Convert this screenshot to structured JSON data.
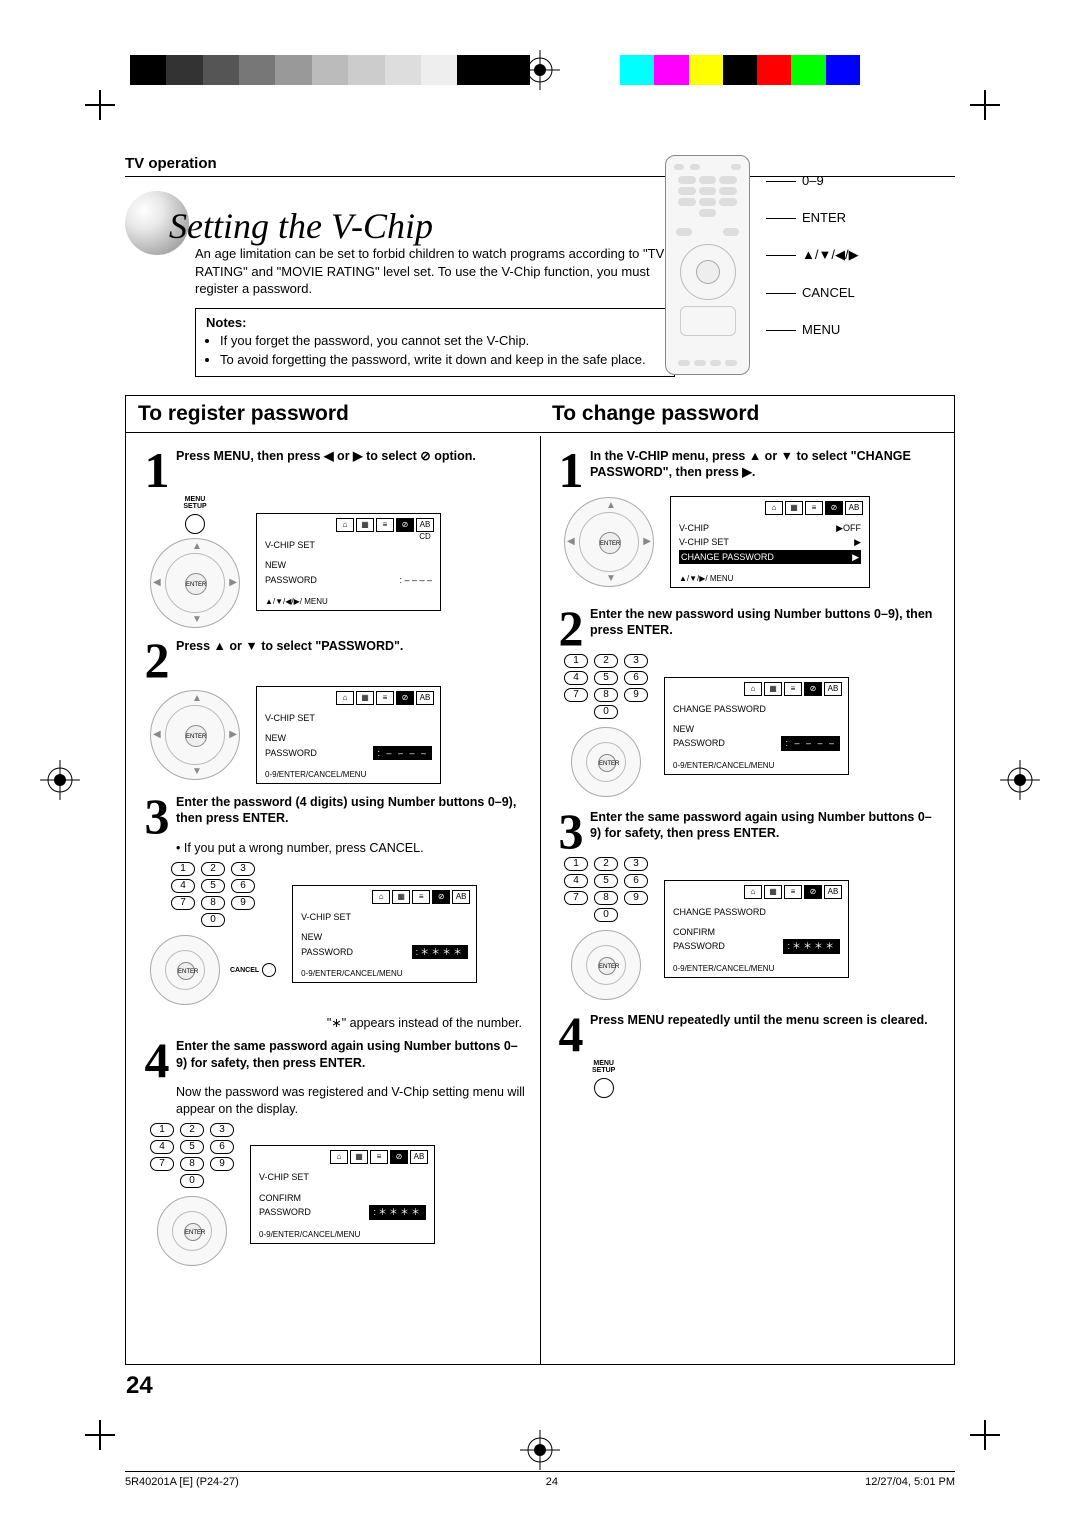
{
  "header": {
    "section": "TV operation",
    "title": "Setting the V-Chip"
  },
  "intro": "An age limitation can be set to forbid children to watch programs according to \"TV RATING\" and \"MOVIE RATING\" level set. To use the V-Chip function, you must register a password.",
  "notes": {
    "heading": "Notes:",
    "items": [
      "If you forget the password, you cannot set the V-Chip.",
      "To avoid forgetting the password, write it down and keep in the safe place."
    ]
  },
  "remote_labels": [
    "0–9",
    "ENTER",
    "▲/▼/◀/▶",
    "CANCEL",
    "MENU"
  ],
  "left_column": {
    "heading": "To register password",
    "steps": [
      {
        "n": "1",
        "text": "Press MENU, then press ◀ or ▶ to select ⊘ option."
      },
      {
        "n": "2",
        "text": "Press ▲ or ▼ to select \"PASSWORD\"."
      },
      {
        "n": "3",
        "text": "Enter the password (4 digits) using Number buttons 0–9), then press ENTER.",
        "sub": "• If you put a wrong number, press CANCEL.",
        "after": "\"∗\" appears instead of the number."
      },
      {
        "n": "4",
        "text": "Enter the same password again using Number buttons 0–9) for safety, then press ENTER.",
        "sub": "Now the password was registered and V-Chip setting menu will appear on the display."
      }
    ],
    "osd": {
      "title": "V-CHIP SET",
      "row_new": "NEW",
      "row_password": "PASSWORD",
      "dashes": ": – – – –",
      "stars": ":＊＊＊＊",
      "confirm": "CONFIRM",
      "foot1": "▲/▼/◀/▶/ MENU",
      "foot2": "0-9/ENTER/CANCEL/MENU"
    }
  },
  "right_column": {
    "heading": "To change password",
    "steps": [
      {
        "n": "1",
        "text": "In the V-CHIP menu, press ▲ or ▼ to select \"CHANGE PASSWORD\", then press ▶."
      },
      {
        "n": "2",
        "text": "Enter the new password using Number buttons 0–9), then press ENTER."
      },
      {
        "n": "3",
        "text": "Enter the same password again using Number buttons 0–9) for safety, then press ENTER."
      },
      {
        "n": "4",
        "text": "Press MENU repeatedly until the menu screen is cleared."
      }
    ],
    "osd1": {
      "rows": [
        {
          "l": "V-CHIP",
          "r": "▶OFF"
        },
        {
          "l": "V-CHIP SET",
          "r": "▶"
        },
        {
          "l": "CHANGE PASSWORD",
          "r": "▶",
          "hl": true
        }
      ],
      "foot": "▲/▼/▶/ MENU"
    },
    "osd2": {
      "title": "CHANGE  PASSWORD",
      "row_new": "NEW",
      "row_password": "PASSWORD",
      "dashes": ": – – – –",
      "foot": "0-9/ENTER/CANCEL/MENU"
    },
    "osd3": {
      "title": "CHANGE  PASSWORD",
      "confirm": "CONFIRM",
      "row_password": "PASSWORD",
      "stars": ":＊＊＊＊",
      "foot": "0-9/ENTER/CANCEL/MENU"
    }
  },
  "misc": {
    "menu_setup": "MENU\nSETUP",
    "enter": "ENTER",
    "cancel": "CANCEL",
    "numpad": [
      "1",
      "2",
      "3",
      "4",
      "5",
      "6",
      "7",
      "8",
      "9",
      "0"
    ]
  },
  "page_number": "24",
  "footer": {
    "left": "5R40201A [E] (P24-27)",
    "mid": "24",
    "right": "12/27/04, 5:01 PM"
  }
}
